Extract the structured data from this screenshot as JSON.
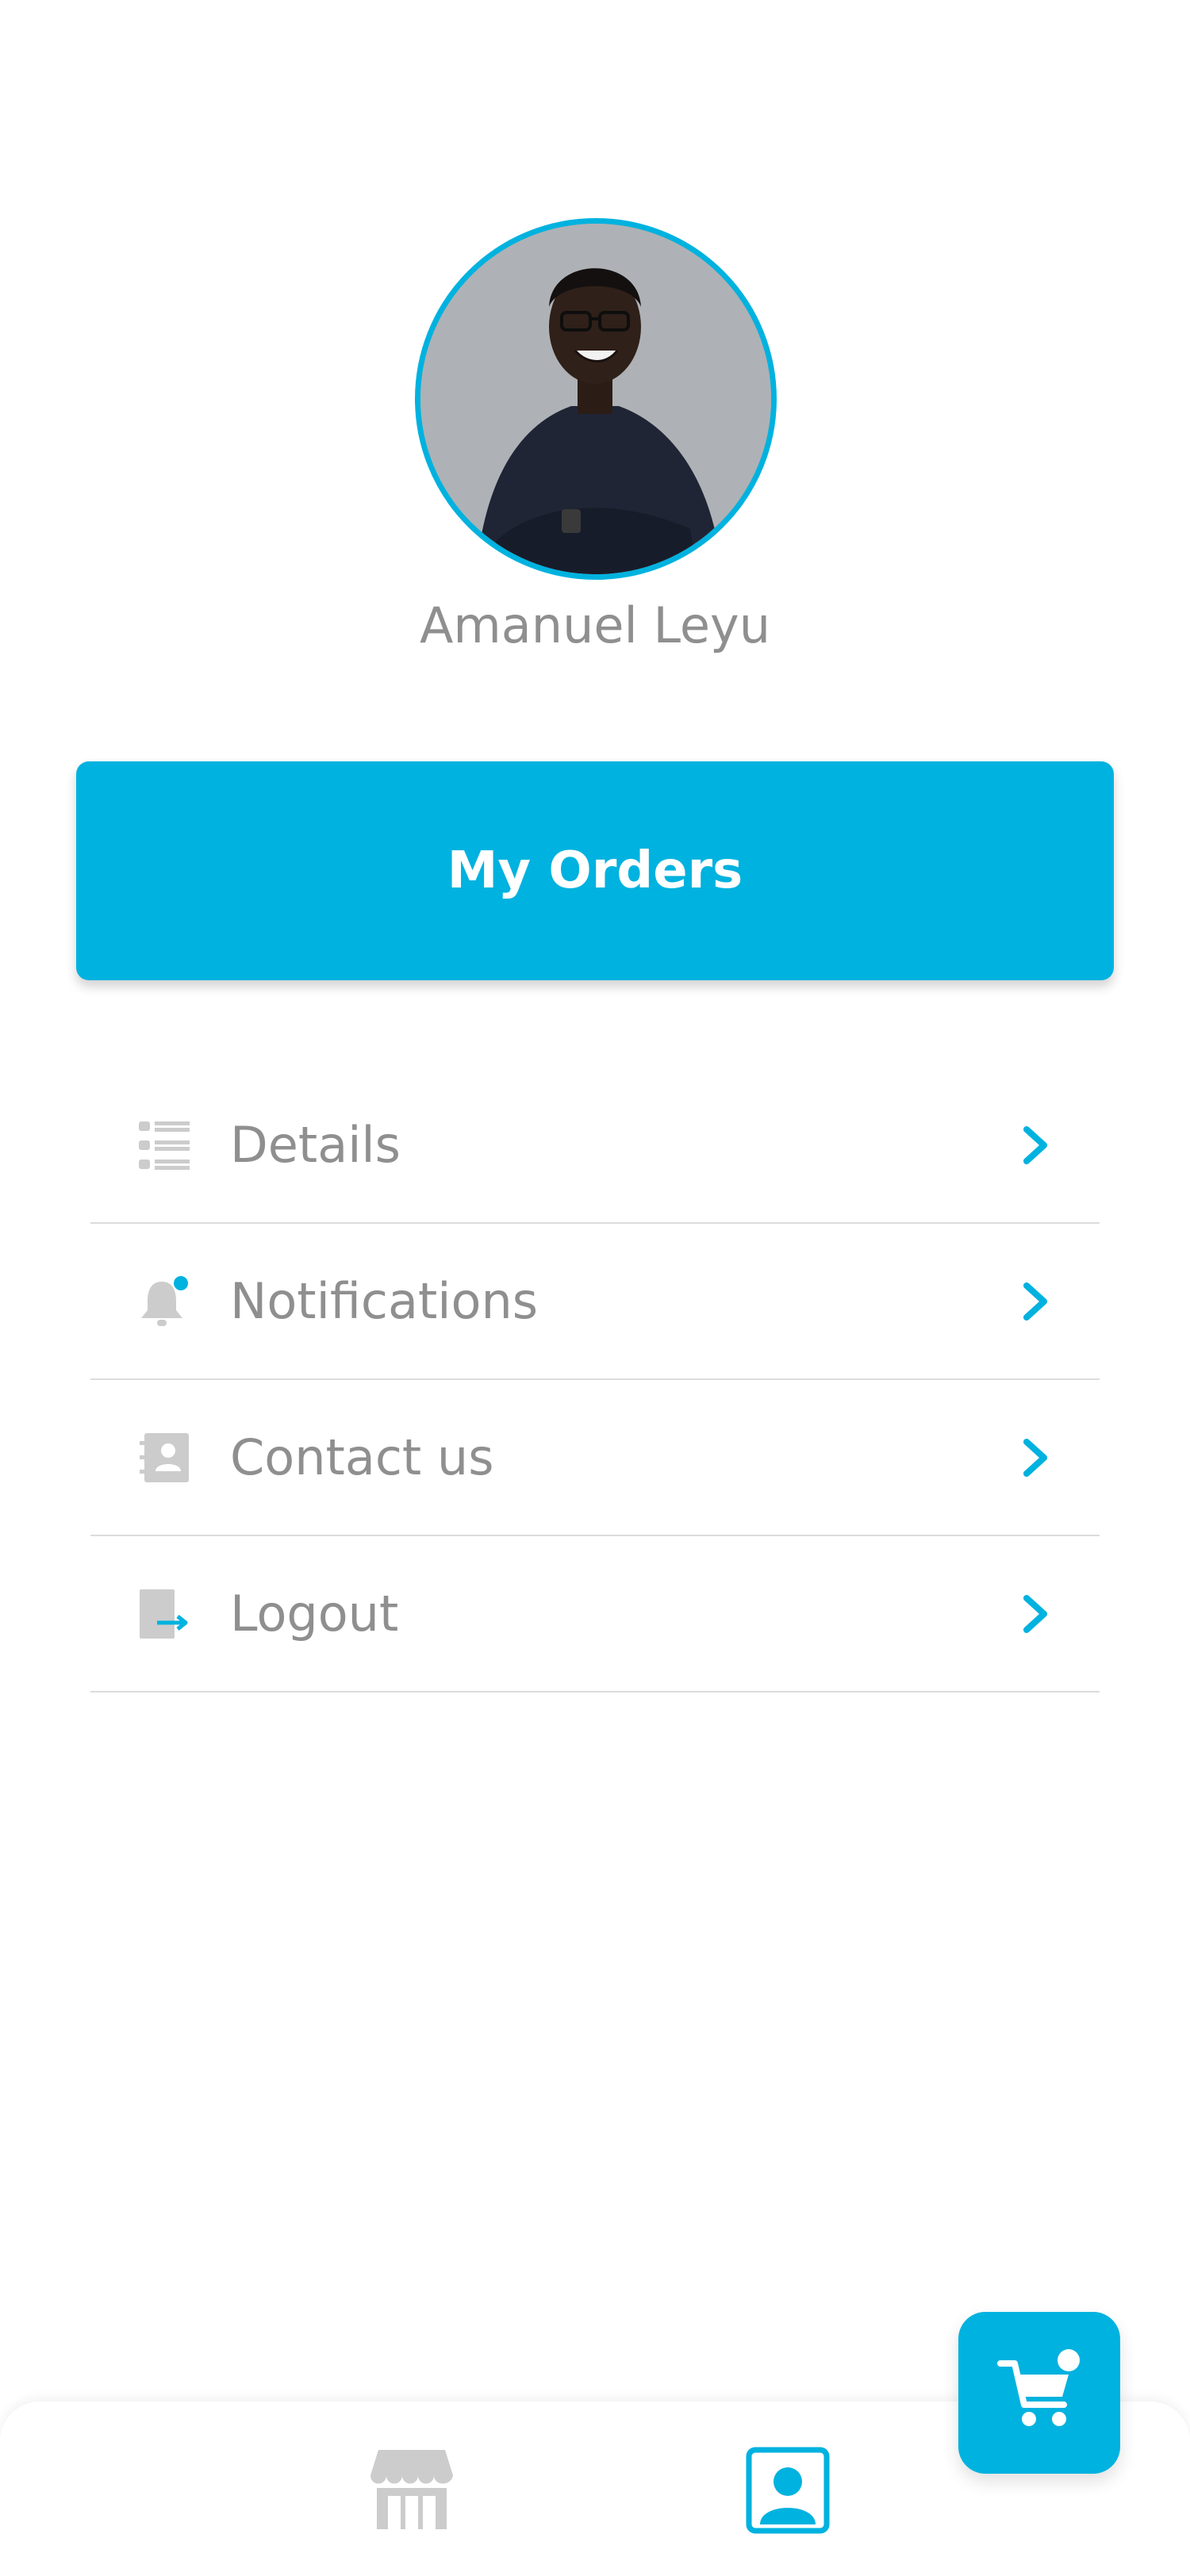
{
  "profile": {
    "name": "Amanuel Leyu"
  },
  "orders_button": {
    "label": "My Orders"
  },
  "menu": {
    "items": [
      {
        "label": "Details",
        "icon": "list-icon"
      },
      {
        "label": "Notifications",
        "icon": "bell-icon"
      },
      {
        "label": "Contact us",
        "icon": "contact-book-icon"
      },
      {
        "label": "Logout",
        "icon": "logout-icon"
      }
    ]
  },
  "bottom_nav": {
    "items": [
      {
        "icon": "store-icon",
        "active": false
      },
      {
        "icon": "profile-icon",
        "active": true
      }
    ]
  },
  "cart": {
    "icon": "cart-icon",
    "badge": true
  },
  "colors": {
    "accent": "#00b2df",
    "text_muted": "#8f8f8f",
    "icon_gray": "#cccccc",
    "divider": "#dcdcdc"
  }
}
